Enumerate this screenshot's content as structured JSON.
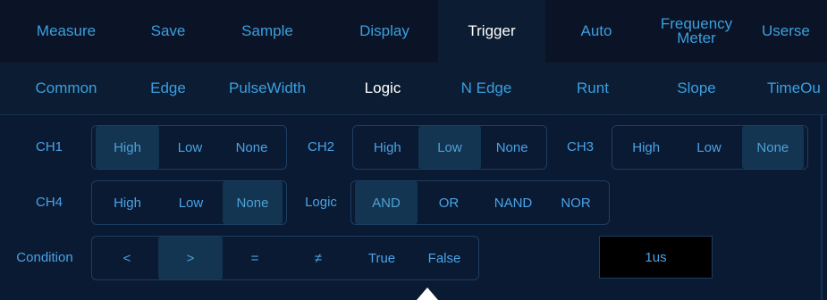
{
  "top_tabs": [
    {
      "label": "Measure"
    },
    {
      "label": "Save"
    },
    {
      "label": "Sample"
    },
    {
      "label": "Display"
    },
    {
      "label": "Trigger"
    },
    {
      "label": "Auto"
    },
    {
      "label": "Frequency Meter"
    },
    {
      "label": "Userse"
    }
  ],
  "active_top_tab": "Trigger",
  "sub_tabs": [
    {
      "label": "Common"
    },
    {
      "label": "Edge"
    },
    {
      "label": "PulseWidth"
    },
    {
      "label": "Logic"
    },
    {
      "label": "N Edge"
    },
    {
      "label": "Runt"
    },
    {
      "label": "Slope"
    },
    {
      "label": "TimeOu"
    }
  ],
  "active_sub_tab": "Logic",
  "channels": {
    "ch1": {
      "label": "CH1",
      "options": [
        "High",
        "Low",
        "None"
      ],
      "selected": "High"
    },
    "ch2": {
      "label": "CH2",
      "options": [
        "High",
        "Low",
        "None"
      ],
      "selected": "Low"
    },
    "ch3": {
      "label": "CH3",
      "options": [
        "High",
        "Low",
        "None"
      ],
      "selected": "None"
    },
    "ch4": {
      "label": "CH4",
      "options": [
        "High",
        "Low",
        "None"
      ],
      "selected": "None"
    }
  },
  "logic": {
    "label": "Logic",
    "options": [
      "AND",
      "OR",
      "NAND",
      "NOR"
    ],
    "selected": "AND"
  },
  "condition": {
    "label": "Condition",
    "options": [
      "<",
      ">",
      "=",
      "≠",
      "True",
      "False"
    ],
    "selected": ">"
  },
  "time_value": "1us",
  "colors": {
    "background": "#0a1a33",
    "topbar": "#0a1426",
    "text_accent": "#3b9fe0",
    "selected_bg": "#133552",
    "active_text": "#ffffff"
  }
}
